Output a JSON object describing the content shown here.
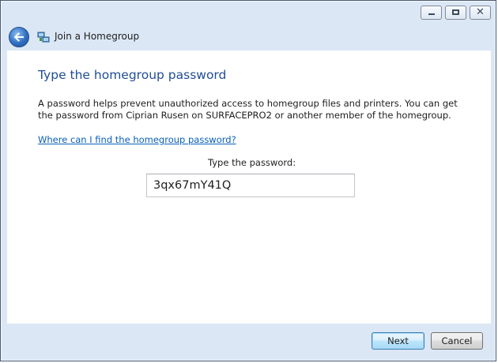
{
  "window": {
    "title": "Join a Homegroup",
    "caption_buttons": [
      "minimize",
      "maximize",
      "close"
    ],
    "close_glyph": "✕"
  },
  "nav": {
    "back_icon": "back-arrow-icon",
    "app_icon": "homegroup-icon",
    "title": "Join a Homegroup"
  },
  "content": {
    "heading": "Type the homegroup password",
    "description": "A password helps prevent unauthorized access to homegroup files and printers. You can get the password from Ciprian Rusen on SURFACEPRO2 or another member of the homegroup.",
    "help_link": "Where can I find the homegroup password?",
    "password_label": "Type the password:",
    "password_value": "3qx67mY41Q"
  },
  "footer": {
    "next_label": "Next",
    "cancel_label": "Cancel"
  },
  "colors": {
    "heading": "#1f4d96",
    "link": "#0a5fb8",
    "frame": "#dbe7f5"
  }
}
